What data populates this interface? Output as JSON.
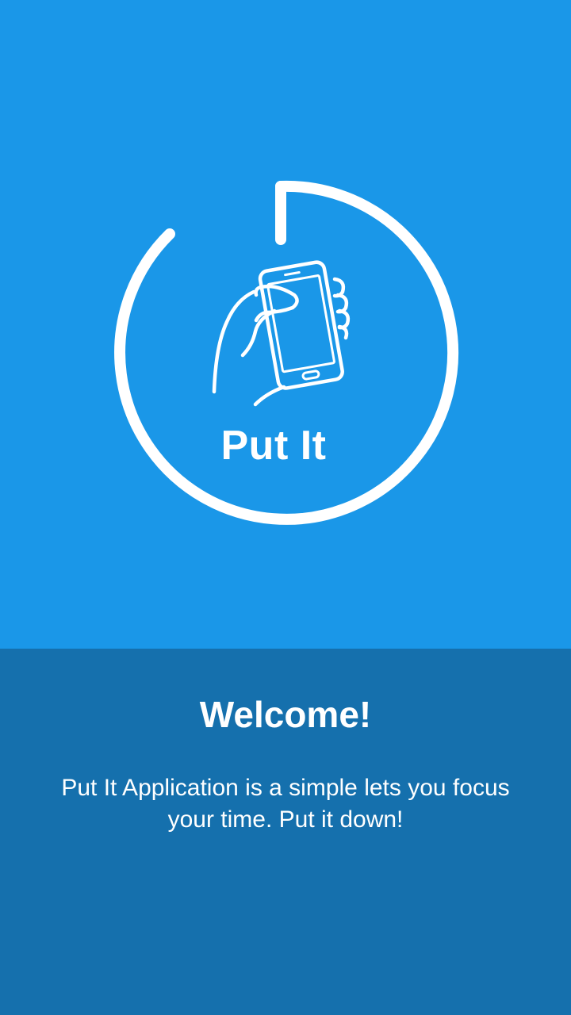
{
  "brand": {
    "app_name": "Put It",
    "primary_color": "#1a97e8",
    "secondary_color": "#1570ad",
    "logo_icon": "hand-holding-phone-icon"
  },
  "welcome": {
    "title": "Welcome!",
    "description": "Put It Application is a simple lets you focus your time. Put it down!"
  }
}
